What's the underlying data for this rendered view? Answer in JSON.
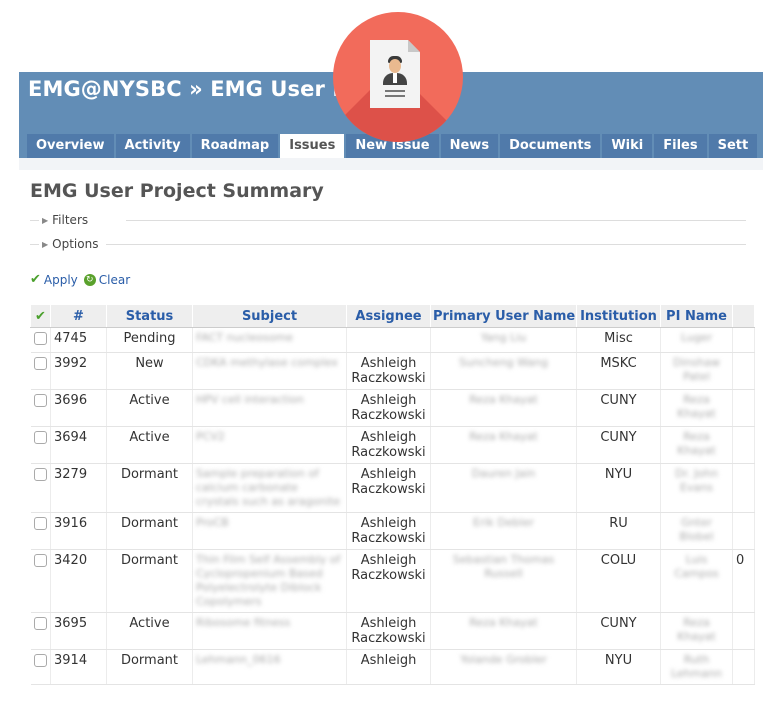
{
  "header": {
    "title": "EMG@NYSBC » EMG User Pr",
    "tabs": [
      {
        "label": "Overview",
        "selected": false
      },
      {
        "label": "Activity",
        "selected": false
      },
      {
        "label": "Roadmap",
        "selected": false
      },
      {
        "label": "Issues",
        "selected": true
      },
      {
        "label": "New issue",
        "selected": false
      },
      {
        "label": "News",
        "selected": false
      },
      {
        "label": "Documents",
        "selected": false
      },
      {
        "label": "Wiki",
        "selected": false
      },
      {
        "label": "Files",
        "selected": false
      },
      {
        "label": "Sett",
        "selected": false
      }
    ]
  },
  "overlay": {
    "icon": "user-document-icon",
    "color": "#f26b5b"
  },
  "page": {
    "heading": "EMG User Project Summary",
    "filters_label": "Filters",
    "options_label": "Options",
    "apply_label": "Apply",
    "clear_label": "Clear"
  },
  "table": {
    "columns": [
      "",
      "#",
      "Status",
      "Subject",
      "Assignee",
      "Primary User Name",
      "Institution",
      "PI Name"
    ],
    "rows": [
      {
        "id": "4745",
        "status": "Pending",
        "subject": "FACT nucleosome",
        "assignee": "",
        "user": "Yang Liu",
        "institution": "Misc",
        "pi": "Luger",
        "extra": ""
      },
      {
        "id": "3992",
        "status": "New",
        "subject": "CDKA methylase complex",
        "assignee": "Ashleigh Raczkowski",
        "user": "Suncheng Wang",
        "institution": "MSKC",
        "pi": "Dinshaw Patel",
        "extra": ""
      },
      {
        "id": "3696",
        "status": "Active",
        "subject": "HPV cell interaction",
        "assignee": "Ashleigh Raczkowski",
        "user": "Reza Khayat",
        "institution": "CUNY",
        "pi": "Reza Khayat",
        "extra": ""
      },
      {
        "id": "3694",
        "status": "Active",
        "subject": "PCV2",
        "assignee": "Ashleigh Raczkowski",
        "user": "Reza Khayat",
        "institution": "CUNY",
        "pi": "Reza Khayat",
        "extra": ""
      },
      {
        "id": "3279",
        "status": "Dormant",
        "subject": "Sample preparation of calcium carbonate crystals such as aragonite",
        "assignee": "Ashleigh Raczkowski",
        "user": "Dauren Jain",
        "institution": "NYU",
        "pi": "Dr. John Evans",
        "extra": ""
      },
      {
        "id": "3916",
        "status": "Dormant",
        "subject": "ProCB",
        "assignee": "Ashleigh Raczkowski",
        "user": "Erik Debler",
        "institution": "RU",
        "pi": "Gnter Blobel",
        "extra": ""
      },
      {
        "id": "3420",
        "status": "Dormant",
        "subject": "Thin Film Self Assembly of Cyclopropenium Based Polyelectrolyte Diblock Copolymers",
        "assignee": "Ashleigh Raczkowski",
        "user": "Sebastian Thomas Russell",
        "institution": "COLU",
        "pi": "Luis Campos",
        "extra": "0"
      },
      {
        "id": "3695",
        "status": "Active",
        "subject": "Ribosome fitness",
        "assignee": "Ashleigh Raczkowski",
        "user": "Reza Khayat",
        "institution": "CUNY",
        "pi": "Reza Khayat",
        "extra": ""
      },
      {
        "id": "3914",
        "status": "Dormant",
        "subject": "Lehmann_0616",
        "assignee": "Ashleigh",
        "user": "Yolande Grobler",
        "institution": "NYU",
        "pi": "Ruth Lehmann",
        "extra": ""
      }
    ]
  }
}
